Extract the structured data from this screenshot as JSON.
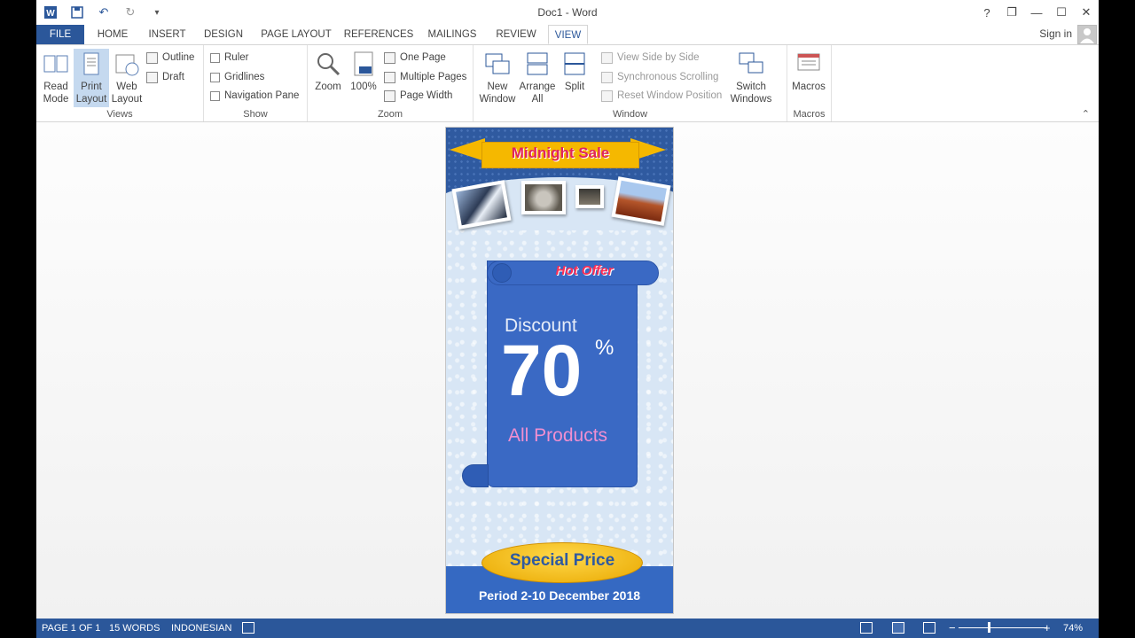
{
  "window": {
    "title": "Doc1 - Word",
    "controls": [
      "?",
      "❐",
      "—",
      "☐",
      "✕"
    ]
  },
  "qat": {
    "app_icon": "word-icon",
    "undo_symbol": "↶",
    "redo_symbol": "↻",
    "customize_symbol": "▾"
  },
  "tabs": {
    "file": "FILE",
    "items": [
      "HOME",
      "INSERT",
      "DESIGN",
      "PAGE LAYOUT",
      "REFERENCES",
      "MAILINGS",
      "REVIEW",
      "VIEW"
    ],
    "active": "VIEW",
    "sign_in": "Sign in"
  },
  "ribbon": {
    "views": {
      "label": "Views",
      "read_mode": "Read Mode",
      "print_layout": "Print Layout",
      "web_layout": "Web Layout",
      "outline": "Outline",
      "draft": "Draft"
    },
    "show": {
      "label": "Show",
      "ruler": "Ruler",
      "gridlines": "Gridlines",
      "navigation_pane": "Navigation Pane"
    },
    "zoom": {
      "label": "Zoom",
      "zoom": "Zoom",
      "hundred": "100%",
      "one_page": "One Page",
      "multiple_pages": "Multiple Pages",
      "page_width": "Page Width"
    },
    "window": {
      "label": "Window",
      "new_window": "New Window",
      "arrange_all": "Arrange All",
      "split": "Split",
      "view_side_by_side": "View Side by Side",
      "synchronous_scrolling": "Synchronous Scrolling",
      "reset_window_position": "Reset Window Position",
      "switch_windows": "Switch Windows"
    },
    "macros": {
      "label": "Macros",
      "macros": "Macros"
    }
  },
  "document": {
    "banner": "Midnight Sale",
    "hot_offer": "Hot Offer",
    "discount": "Discount",
    "amount": "70",
    "percent": "%",
    "all_products": "All Products",
    "special_price": "Special Price",
    "period": "Period 2-10 December 2018"
  },
  "status": {
    "page": "PAGE 1 OF 1",
    "words": "15 WORDS",
    "language": "INDONESIAN",
    "zoom_minus": "−",
    "zoom_plus": "+",
    "zoom_level": "74%"
  },
  "colors": {
    "accent": "#2b579a",
    "banner_yellow": "#f5b800",
    "scroll_blue": "#3a69c4",
    "hot_offer_red": "#ff2d55",
    "products_pink": "#f08fd0"
  }
}
